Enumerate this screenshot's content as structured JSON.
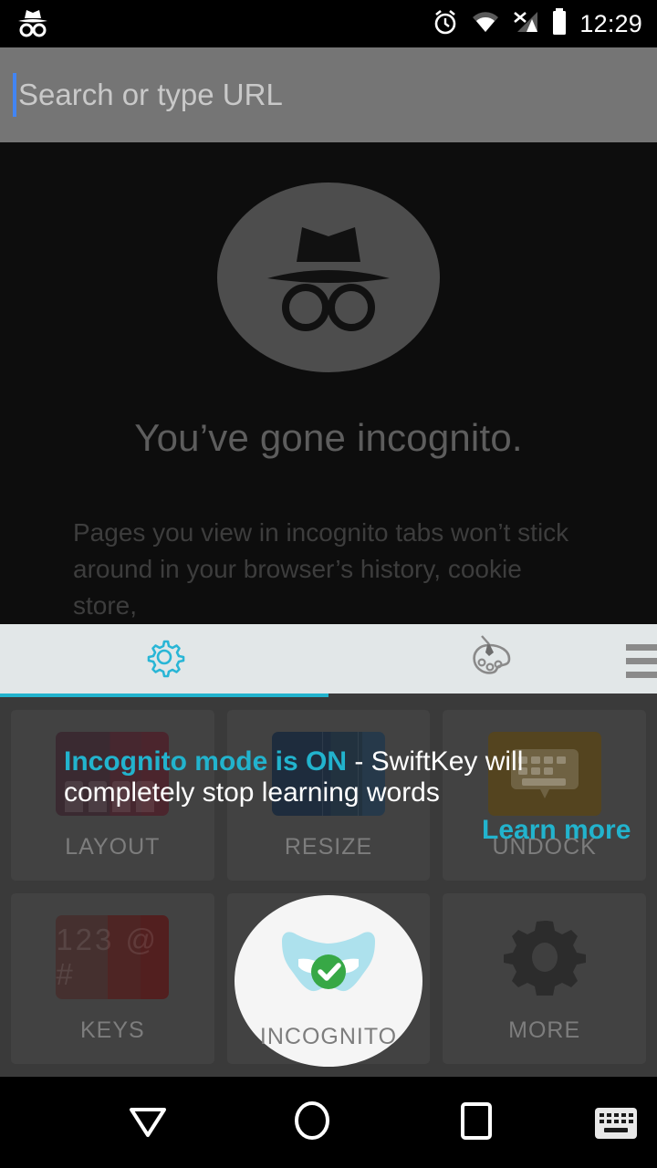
{
  "statusbar": {
    "time": "12:29",
    "icons": [
      "incognito-hat-icon",
      "alarm-icon",
      "wifi-icon",
      "signal-no-service-icon",
      "battery-icon"
    ]
  },
  "omnibox": {
    "placeholder": "Search or type URL",
    "value": "",
    "caret_color": "#4285f4"
  },
  "page": {
    "icon": "incognito-avatar-icon",
    "title": "You’ve gone incognito.",
    "body": "Pages you view in incognito tabs won’t stick around in your browser’s history, cookie store,"
  },
  "keyboard": {
    "toolbar": {
      "tabs": [
        {
          "name": "settings",
          "icon": "gear-icon",
          "active": true
        },
        {
          "name": "themes",
          "icon": "palette-icon",
          "active": false
        }
      ],
      "menu_icon": "hamburger-menu-icon",
      "accent": "#22b3cd",
      "background": "#e2e7e8"
    },
    "tiles": [
      {
        "label": "LAYOUT",
        "icon": "layout-tile-icon"
      },
      {
        "label": "RESIZE",
        "icon": "resize-tile-icon"
      },
      {
        "label": "UNDOCK",
        "icon": "undock-keyboard-icon"
      },
      {
        "label": "KEYS",
        "icon": "keys-tile-icon",
        "glyphs": "123 @ #"
      },
      {
        "label": "INCOGNITO",
        "icon": "incognito-mask-icon",
        "highlighted": true
      },
      {
        "label": "MORE",
        "icon": "gear-icon"
      }
    ],
    "coachmark": {
      "highlight": "Incognito mode is ON",
      "rest": " - SwiftKey will completely stop learning words",
      "learn_more": "Learn more",
      "highlight_color": "#22b3cd"
    }
  },
  "navbar": {
    "buttons": [
      {
        "name": "back",
        "icon": "triangle-down-icon"
      },
      {
        "name": "home",
        "icon": "circle-icon"
      },
      {
        "name": "recents",
        "icon": "square-icon"
      }
    ],
    "keyboard_indicator": "keyboard-icon"
  }
}
